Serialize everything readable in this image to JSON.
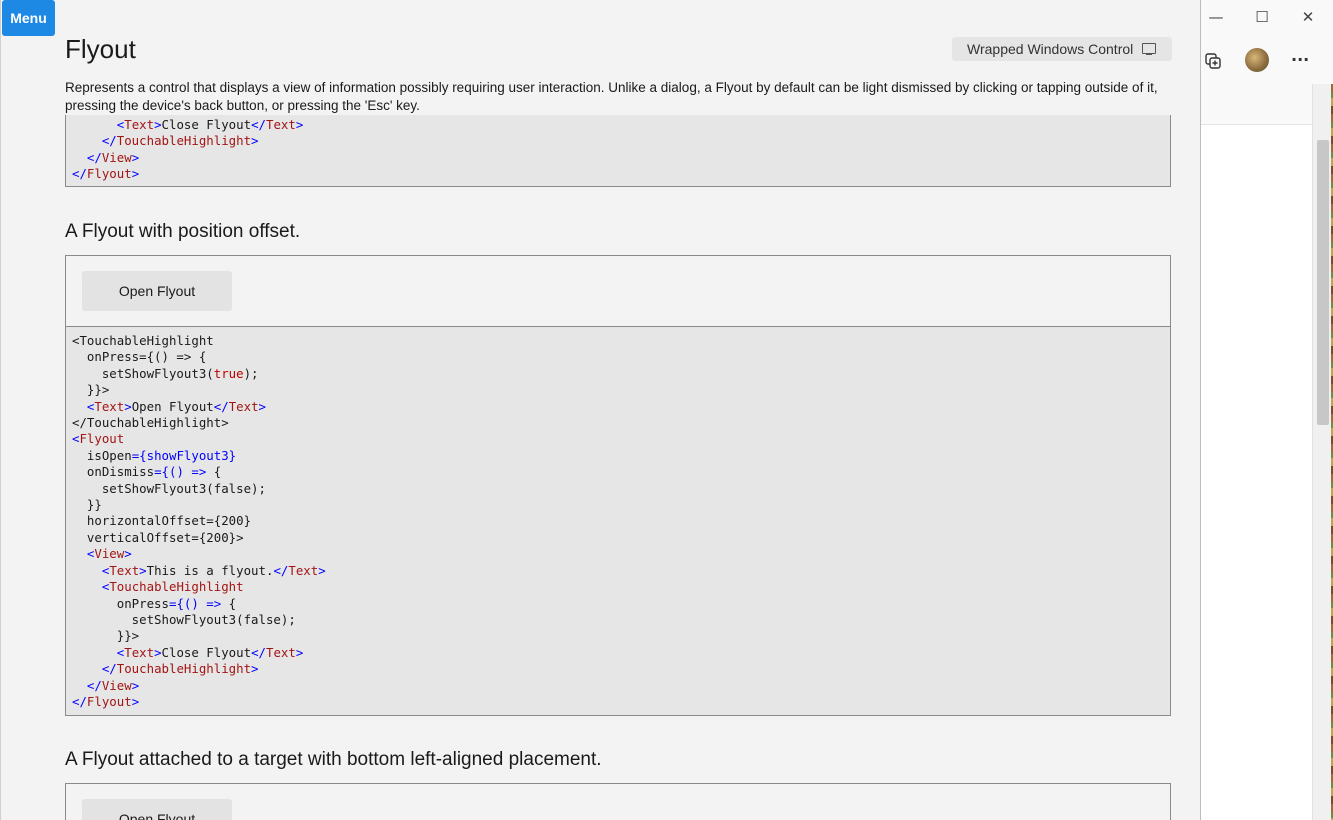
{
  "app": {
    "menu_label": "Menu",
    "title": "Flyout",
    "wrapped_label": "Wrapped Windows Control",
    "description": "Represents a control that displays a view of information possibly requiring user interaction. Unlike a dialog, a Flyout by default can be light dismissed by clicking or tapping outside of it, pressing the device's back button, or pressing the 'Esc' key."
  },
  "sections": [
    {
      "heading": "A Flyout with position offset.",
      "button_label": "Open Flyout"
    },
    {
      "heading": "A Flyout attached to a target with bottom left-aligned placement.",
      "button_label": "Open Flyout"
    }
  ],
  "code_top_lines": [
    "      <Text>Close Flyout</Text>",
    "    </TouchableHighlight>",
    "  </View>",
    "</Flyout>"
  ],
  "browser": {
    "minimize": "—",
    "maximize": "☐",
    "close": "✕",
    "more": "···"
  }
}
